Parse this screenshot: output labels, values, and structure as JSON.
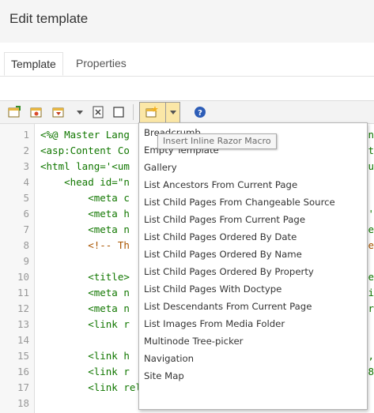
{
  "header": {
    "title": "Edit template"
  },
  "tabs": [
    {
      "label": "Template",
      "active": true
    },
    {
      "label": "Properties",
      "active": false
    }
  ],
  "toolbar": {
    "icons": [
      "insert-code-icon",
      "insert-template-icon",
      "insert-field-icon",
      "dropdown-arrow-icon",
      "insert-dictionary-icon",
      "insert-content-icon",
      "insert-macro-icon",
      "macro-dropdown-arrow-icon",
      "help-icon"
    ],
    "tooltip": "Insert Inline Razor Macro",
    "accent_color": "#fbe7a7"
  },
  "editor": {
    "line_numbers": [
      "1",
      "2",
      "3",
      "4",
      "5",
      "6",
      "7",
      "8",
      "9",
      "10",
      "11",
      "12",
      "13",
      "14",
      "15",
      "16",
      "17",
      "18"
    ],
    "lines": [
      {
        "text": "<%@ Master Lang",
        "right": "/n"
      },
      {
        "text": "<asp:Content Co",
        "right": "nt"
      },
      {
        "text": "<html lang='<um",
        "right": "ru"
      },
      {
        "text": "    <head id=\"n",
        "right": ""
      },
      {
        "text": "        <meta c",
        "right": ""
      },
      {
        "text": "        <meta h",
        "right": "='"
      },
      {
        "text": "        <meta n",
        "right": "e"
      },
      {
        "text": "        <!-- Th",
        "right": "e"
      },
      {
        "text": "",
        "right": ""
      },
      {
        "text": "        <title>",
        "right": "me"
      },
      {
        "text": "        <meta n",
        "right": "ri"
      },
      {
        "text": "        <meta n",
        "right": "Ur"
      },
      {
        "text": "        <link r",
        "right": ""
      },
      {
        "text": "",
        "right": ""
      },
      {
        "text": "        <link h",
        "right": ","
      },
      {
        "text": "        <link r",
        "right": "8"
      },
      {
        "text": "        <link rel=\"stylesheet\" href=\"https://maxcdn",
        "right": ""
      },
      {
        "text": "",
        "right": ""
      }
    ]
  },
  "macro_menu": {
    "items": [
      "Breadcrumb",
      "Empty Template",
      "Gallery",
      "List Ancestors From Current Page",
      "List Child Pages From Changeable Source",
      "List Child Pages From Current Page",
      "List Child Pages Ordered By Date",
      "List Child Pages Ordered By Name",
      "List Child Pages Ordered By Property",
      "List Child Pages With Doctype",
      "List Descendants From Current Page",
      "List Images From Media Folder",
      "Multinode Tree-picker",
      "Navigation",
      "Site Map"
    ]
  }
}
